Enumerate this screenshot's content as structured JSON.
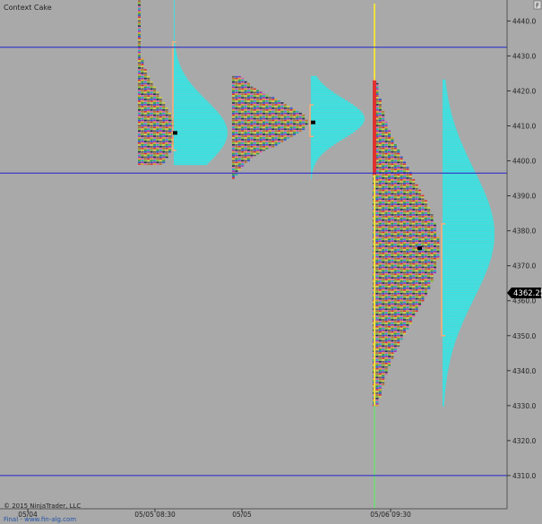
{
  "window": {
    "title": "Context Cake",
    "corner_button": "F"
  },
  "footer": {
    "copyright": "© 2015 NinjaTrader, LLC",
    "credit": "Final - www.fin-alg.com"
  },
  "colors": {
    "background": "#a9a9a9",
    "reference_line": "#2222cc",
    "volume_profile": "#36e4e4",
    "value_area": "#f5b07a",
    "current_session_line": "#f0e040",
    "price_marker_bg": "#000000",
    "price_marker_text": "#ffffff"
  },
  "chart_data": {
    "type": "market-profile",
    "title": "Context Cake",
    "y_range": [
      4300.5,
      4446
    ],
    "y_ticks": [
      4310,
      4320,
      4330,
      4340,
      4350,
      4360,
      4370,
      4380,
      4390,
      4400,
      4410,
      4420,
      4430,
      4440
    ],
    "x_ticks": [
      "05/04",
      "05/05 08:30",
      "05/05",
      "05/06 09:30"
    ],
    "current_price": 4362.25,
    "current_price_label": "4362.25",
    "reference_lines": [
      4432.5,
      4396.5,
      4310
    ],
    "grid": false,
    "sessions": [
      {
        "label": "05/05 08:30",
        "tpo_range": [
          4399,
          4446
        ],
        "poc": 4408,
        "value_area": [
          4403,
          4434
        ],
        "volume_peak": 4408
      },
      {
        "label": "05/05",
        "tpo_range": [
          4395,
          4424
        ],
        "poc": 4411,
        "value_area": [
          4407,
          4416
        ],
        "volume_peak": 4412
      },
      {
        "label": "05/06 09:30",
        "tpo_range": [
          4330,
          4423
        ],
        "poc": 4375,
        "value_area": [
          4350,
          4382
        ],
        "volume_peak": 4379
      }
    ]
  }
}
